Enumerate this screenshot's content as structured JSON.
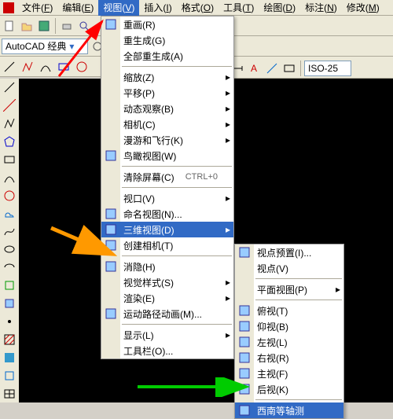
{
  "menubar": {
    "items": [
      {
        "label": "文件",
        "u": "F"
      },
      {
        "label": "编辑",
        "u": "E"
      },
      {
        "label": "视图",
        "u": "V",
        "hot": true
      },
      {
        "label": "插入",
        "u": "I"
      },
      {
        "label": "格式",
        "u": "O"
      },
      {
        "label": "工具",
        "u": "T"
      },
      {
        "label": "绘图",
        "u": "D"
      },
      {
        "label": "标注",
        "u": "N"
      },
      {
        "label": "修改",
        "u": "M"
      }
    ]
  },
  "workspace_combo": "AutoCAD 经典",
  "dimstyle_combo": "ISO-25",
  "view_menu": {
    "items": [
      {
        "label": "重画(R)",
        "icon": "redraw"
      },
      {
        "label": "重生成(G)"
      },
      {
        "label": "全部重生成(A)"
      },
      {
        "sep": true
      },
      {
        "label": "缩放(Z)",
        "sub": true
      },
      {
        "label": "平移(P)",
        "sub": true
      },
      {
        "label": "动态观察(B)",
        "sub": true
      },
      {
        "label": "相机(C)",
        "sub": true
      },
      {
        "label": "漫游和飞行(K)",
        "sub": true
      },
      {
        "label": "鸟瞰视图(W)",
        "icon": "aerial"
      },
      {
        "sep": true
      },
      {
        "label": "清除屏幕(C)",
        "shortcut": "CTRL+0"
      },
      {
        "sep": true
      },
      {
        "label": "视口(V)",
        "sub": true
      },
      {
        "label": "命名视图(N)...",
        "icon": "named-view"
      },
      {
        "label": "三维视图(D)",
        "sub": true,
        "hi": true,
        "icon": "3d"
      },
      {
        "label": "创建相机(T)",
        "icon": "camera"
      },
      {
        "sep": true
      },
      {
        "label": "消隐(H)",
        "icon": "hide"
      },
      {
        "label": "视觉样式(S)",
        "sub": true
      },
      {
        "label": "渲染(E)",
        "sub": true
      },
      {
        "label": "运动路径动画(M)...",
        "icon": "motion"
      },
      {
        "sep": true
      },
      {
        "label": "显示(L)",
        "sub": true
      },
      {
        "label": "工具栏(O)..."
      }
    ]
  },
  "sub_menu": {
    "items": [
      {
        "label": "视点预置(I)...",
        "icon": "preset"
      },
      {
        "label": "视点(V)"
      },
      {
        "sep": true
      },
      {
        "label": "平面视图(P)",
        "sub": true
      },
      {
        "sep": true
      },
      {
        "label": "俯视(T)",
        "icon": "cube"
      },
      {
        "label": "仰视(B)",
        "icon": "cube"
      },
      {
        "label": "左视(L)",
        "icon": "cube"
      },
      {
        "label": "右视(R)",
        "icon": "cube"
      },
      {
        "label": "主视(F)",
        "icon": "cube"
      },
      {
        "label": "后视(K)",
        "icon": "cube"
      },
      {
        "sep": true
      },
      {
        "label": "西南等轴测",
        "icon": "iso",
        "hi": true
      }
    ]
  }
}
